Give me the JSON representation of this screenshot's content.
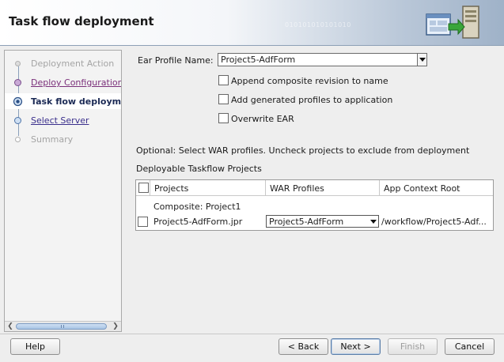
{
  "window": {
    "title": "Task flow deployment",
    "header_binary_text": "010101010101010"
  },
  "steps": [
    {
      "label": "Deployment Action",
      "state": "disabled"
    },
    {
      "label": "Deploy Configuration",
      "state": "visited"
    },
    {
      "label": "Task flow deployment",
      "state": "current"
    },
    {
      "label": "Select Server",
      "state": "link"
    },
    {
      "label": "Summary",
      "state": "disabled"
    }
  ],
  "form": {
    "ear_profile_label": "Ear Profile Name:",
    "ear_profile_value": "Project5-AdfForm",
    "append_revision_label": "Append composite revision to name",
    "append_revision_checked": false,
    "add_profiles_label": "Add generated profiles to application",
    "add_profiles_checked": false,
    "overwrite_ear_label": "Overwrite EAR",
    "overwrite_ear_checked": false,
    "war_instructions": "Optional: Select WAR profiles. Uncheck projects to exclude from deployment",
    "deployable_label": "Deployable Taskflow Projects"
  },
  "table": {
    "columns": [
      "Projects",
      "WAR Profiles",
      "App Context Root"
    ],
    "group_label": "Composite:  Project1",
    "rows": [
      {
        "checked": false,
        "project": "Project5-AdfForm.jpr",
        "war_profile": "Project5-AdfForm",
        "context_root": "/workflow/Project5-Adf..."
      }
    ]
  },
  "buttons": {
    "help": "Help",
    "back": "< Back",
    "next": "Next >",
    "finish": "Finish",
    "cancel": "Cancel"
  },
  "colors": {
    "current_step": "#1b2a55",
    "visited_link": "#7a2f7a",
    "link": "#3a2f8c",
    "disabled_text": "#a4a4a4"
  }
}
